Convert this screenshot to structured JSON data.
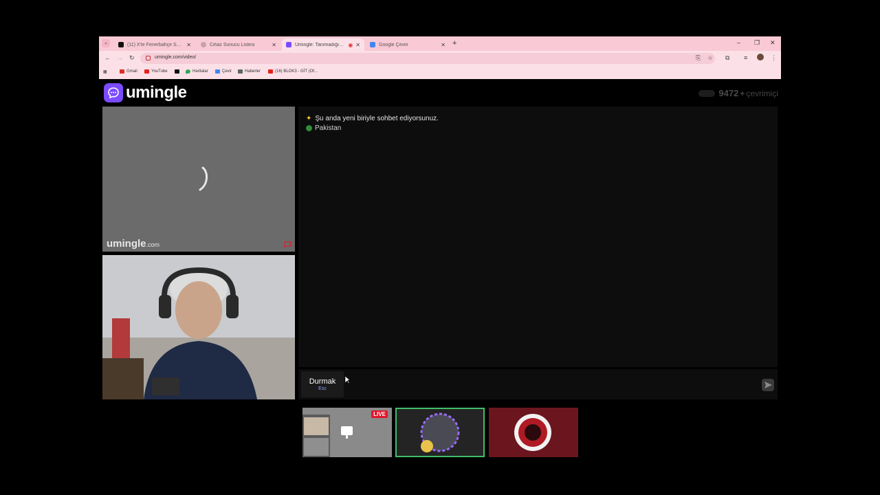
{
  "browser": {
    "tabs": [
      {
        "label": "(11) X'te Fenerbahçe SK: \"🐦 ...",
        "favicon": "x-logo-icon",
        "active": false
      },
      {
        "label": "Cihaz Sunucu Listesi",
        "favicon": "globe-icon",
        "active": false
      },
      {
        "label": "Umingle: Tanımadığınız Kişi...",
        "favicon": "umingle-icon",
        "active": true
      },
      {
        "label": "Google Çeviri",
        "favicon": "translate-icon",
        "active": false
      }
    ],
    "url": "umingle.com/video/",
    "bookmarks": [
      {
        "label": "Gmail",
        "color": "#d93025"
      },
      {
        "label": "YouTube",
        "color": "#e62117"
      },
      {
        "label": "",
        "color": "#111111"
      },
      {
        "label": "Haritalar",
        "color": "#34a853"
      },
      {
        "label": "Çevir",
        "color": "#4285f4"
      },
      {
        "label": "Haberler",
        "color": "#5f6368"
      },
      {
        "label": "(16) BLOK3 - GİT (Of...",
        "color": "#e62117"
      }
    ]
  },
  "site": {
    "logo": "umingle",
    "online_count": "9472",
    "online_plus": "+",
    "online_label": "çevrimiçi",
    "watermark": "umingle",
    "watermark_suffix": ".com"
  },
  "chat": {
    "system_message": "Şu anda yeni biriyle sohbet ediyorsunuz.",
    "country": "Pakistan"
  },
  "composer": {
    "stop_label": "Durmak",
    "stop_shortcut": "Esc"
  },
  "overlay": {
    "live_badge": "LIVE"
  },
  "colors": {
    "browser_chrome": "#f9c9d6",
    "accent": "#7b4bff",
    "chat_bg": "#0d0d0d"
  }
}
